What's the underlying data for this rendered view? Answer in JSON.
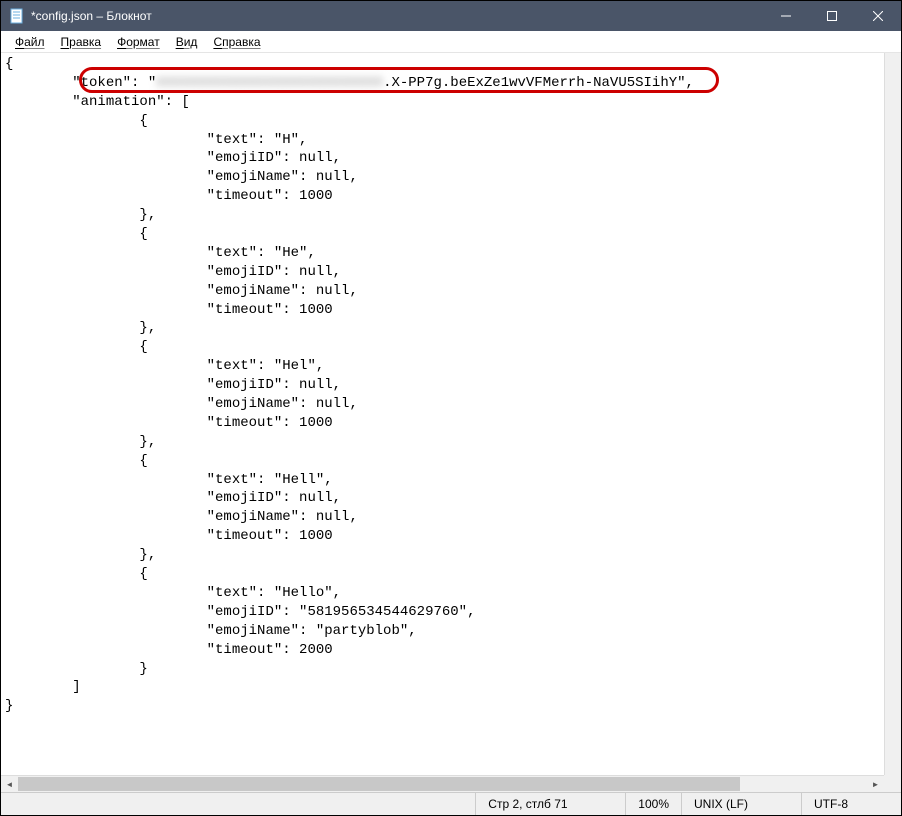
{
  "titlebar": {
    "title": "*config.json – Блокнот"
  },
  "menu": {
    "file": "Файл",
    "edit": "Правка",
    "format": "Формат",
    "view": "Вид",
    "help": "Справка"
  },
  "editor": {
    "open_brace": "{",
    "token_key": "\"token\": \"",
    "token_blurred": "XXXXXXXXXXXXXXXXXXXXXXXXXXX",
    "token_tail": ".X-PP7g.beExZe1wvVFMerrh-NaVU5SIihY\",",
    "animation_key": "\"animation\": [",
    "frames": [
      {
        "text": "H",
        "emojiID": "null",
        "emojiName": "null",
        "timeout": "1000"
      },
      {
        "text": "He",
        "emojiID": "null",
        "emojiName": "null",
        "timeout": "1000"
      },
      {
        "text": "Hel",
        "emojiID": "null",
        "emojiName": "null",
        "timeout": "1000"
      },
      {
        "text": "Hell",
        "emojiID": "null",
        "emojiName": "null",
        "timeout": "1000"
      },
      {
        "text": "Hello",
        "emojiID": "\"581956534544629760\"",
        "emojiName": "\"partyblob\"",
        "timeout": "2000"
      }
    ],
    "close_array": "]",
    "close_brace": "}"
  },
  "statusbar": {
    "cursor": "Стр 2, стлб 71",
    "zoom": "100%",
    "lineending": "UNIX (LF)",
    "encoding": "UTF-8"
  }
}
